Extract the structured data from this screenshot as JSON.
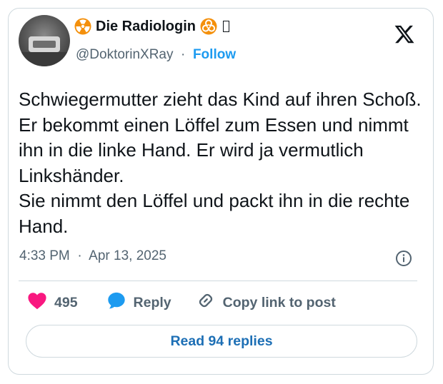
{
  "author": {
    "display_name": "Die Radiologin",
    "handle": "@DoktorinXRay",
    "separator": "·",
    "follow_label": "Follow"
  },
  "tweet": {
    "text": "Schwiegermutter zieht das Kind auf ihren Schoß. Er bekommt einen Löffel zum Essen und nimmt ihn in die linke Hand. Er wird ja vermutlich Linkshänder.\nSie nimmt den Löffel und packt ihn in die rechte Hand.",
    "time": "4:33 PM",
    "separator": "·",
    "date": "Apr 13, 2025"
  },
  "actions": {
    "like_count": "495",
    "reply_label": "Reply",
    "copy_link_label": "Copy link to post"
  },
  "read_replies_label": "Read 94 replies",
  "colors": {
    "accent": "#1d9bf0",
    "heart": "#f91880",
    "text_primary": "#0f1419",
    "text_secondary": "#536471",
    "border": "#cfd9de",
    "hazard": "#f4900c"
  },
  "icons": {
    "name_prefix": "radioactive-icon",
    "name_suffix": "biohazard-icon",
    "platform_logo": "x-logo-icon",
    "info": "info-icon",
    "like": "heart-icon",
    "reply": "reply-bubble-icon",
    "copy_link": "link-icon"
  }
}
